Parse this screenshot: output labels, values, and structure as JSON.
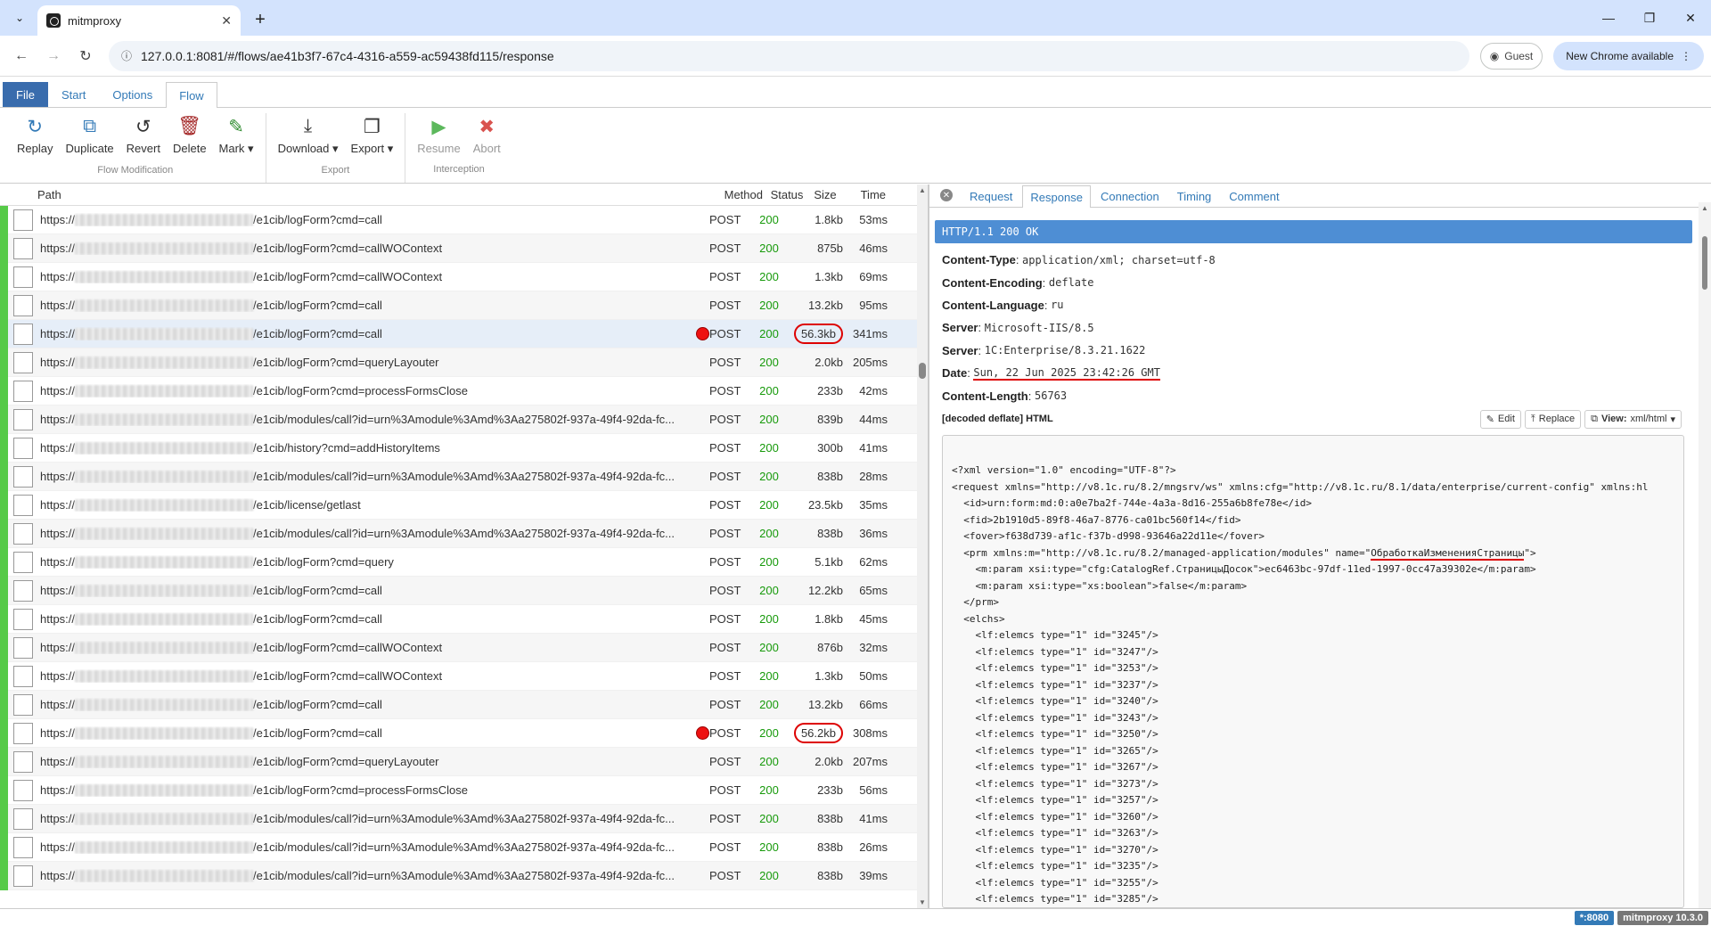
{
  "browser": {
    "tab_title": "mitmproxy",
    "url": "127.0.0.1:8081/#/flows/ae41b3f7-67c4-4316-a559-ac59438fd115/response",
    "guest_label": "Guest",
    "chrome_update_label": "New Chrome available"
  },
  "menu_tabs": [
    "File",
    "Start",
    "Options",
    "Flow"
  ],
  "ribbon": {
    "groups": [
      {
        "title": "Flow Modification",
        "buttons": [
          {
            "label": "Replay",
            "icon": "replay-icon",
            "color": "#337ab7"
          },
          {
            "label": "Duplicate",
            "icon": "duplicate-icon",
            "color": "#337ab7"
          },
          {
            "label": "Revert",
            "icon": "revert-icon",
            "color": "#333333"
          },
          {
            "label": "Delete",
            "icon": "delete-icon",
            "color": "#a52a2a"
          },
          {
            "label": "Mark",
            "icon": "mark-icon",
            "color": "#2e8b2e"
          }
        ]
      },
      {
        "title": "Export",
        "buttons": [
          {
            "label": "Download",
            "icon": "download-icon",
            "color": "#333333"
          },
          {
            "label": "Export",
            "icon": "export-icon",
            "color": "#333333"
          }
        ]
      },
      {
        "title": "Interception",
        "buttons": [
          {
            "label": "Resume",
            "icon": "resume-icon",
            "color": "#5cb85c"
          },
          {
            "label": "Abort",
            "icon": "abort-icon",
            "color": "#d9534f"
          }
        ]
      }
    ]
  },
  "flow_list": {
    "headers": {
      "path": "Path",
      "method": "Method",
      "status": "Status",
      "size": "Size",
      "time": "Time"
    },
    "rows": [
      {
        "prefix": "https://",
        "path": "/e1cib/logForm?cmd=call",
        "method": "POST",
        "status": "200",
        "size": "1.8kb",
        "time": "53ms"
      },
      {
        "prefix": "https://",
        "path": "/e1cib/logForm?cmd=callWOContext",
        "method": "POST",
        "status": "200",
        "size": "875b",
        "time": "46ms"
      },
      {
        "prefix": "https://",
        "path": "/e1cib/logForm?cmd=callWOContext",
        "method": "POST",
        "status": "200",
        "size": "1.3kb",
        "time": "69ms"
      },
      {
        "prefix": "https://",
        "path": "/e1cib/logForm?cmd=call",
        "method": "POST",
        "status": "200",
        "size": "13.2kb",
        "time": "95ms"
      },
      {
        "prefix": "https://",
        "path": "/e1cib/logForm?cmd=call",
        "method": "POST",
        "status": "200",
        "size": "56.3kb",
        "time": "341ms",
        "selected": true,
        "intercepted": true,
        "circled": true
      },
      {
        "prefix": "https://",
        "path": "/e1cib/logForm?cmd=queryLayouter",
        "method": "POST",
        "status": "200",
        "size": "2.0kb",
        "time": "205ms"
      },
      {
        "prefix": "https://",
        "path": "/e1cib/logForm?cmd=processFormsClose",
        "method": "POST",
        "status": "200",
        "size": "233b",
        "time": "42ms"
      },
      {
        "prefix": "https://",
        "path": "/e1cib/modules/call?id=urn%3Amodule%3Amd%3Aa275802f-937a-49f4-92da-fc...",
        "method": "POST",
        "status": "200",
        "size": "839b",
        "time": "44ms"
      },
      {
        "prefix": "https://",
        "path": "/e1cib/history?cmd=addHistoryItems",
        "method": "POST",
        "status": "200",
        "size": "300b",
        "time": "41ms"
      },
      {
        "prefix": "https://",
        "path": "/e1cib/modules/call?id=urn%3Amodule%3Amd%3Aa275802f-937a-49f4-92da-fc...",
        "method": "POST",
        "status": "200",
        "size": "838b",
        "time": "28ms"
      },
      {
        "prefix": "https://",
        "path": "/e1cib/license/getlast",
        "method": "POST",
        "status": "200",
        "size": "23.5kb",
        "time": "35ms"
      },
      {
        "prefix": "https://",
        "path": "/e1cib/modules/call?id=urn%3Amodule%3Amd%3Aa275802f-937a-49f4-92da-fc...",
        "method": "POST",
        "status": "200",
        "size": "838b",
        "time": "36ms"
      },
      {
        "prefix": "https://",
        "path": "/e1cib/logForm?cmd=query",
        "method": "POST",
        "status": "200",
        "size": "5.1kb",
        "time": "62ms"
      },
      {
        "prefix": "https://",
        "path": "/e1cib/logForm?cmd=call",
        "method": "POST",
        "status": "200",
        "size": "12.2kb",
        "time": "65ms"
      },
      {
        "prefix": "https://",
        "path": "/e1cib/logForm?cmd=call",
        "method": "POST",
        "status": "200",
        "size": "1.8kb",
        "time": "45ms"
      },
      {
        "prefix": "https://",
        "path": "/e1cib/logForm?cmd=callWOContext",
        "method": "POST",
        "status": "200",
        "size": "876b",
        "time": "32ms"
      },
      {
        "prefix": "https://",
        "path": "/e1cib/logForm?cmd=callWOContext",
        "method": "POST",
        "status": "200",
        "size": "1.3kb",
        "time": "50ms"
      },
      {
        "prefix": "https://",
        "path": "/e1cib/logForm?cmd=call",
        "method": "POST",
        "status": "200",
        "size": "13.2kb",
        "time": "66ms"
      },
      {
        "prefix": "https://",
        "path": "/e1cib/logForm?cmd=call",
        "method": "POST",
        "status": "200",
        "size": "56.2kb",
        "time": "308ms",
        "intercepted": true,
        "circled": true
      },
      {
        "prefix": "https://",
        "path": "/e1cib/logForm?cmd=queryLayouter",
        "method": "POST",
        "status": "200",
        "size": "2.0kb",
        "time": "207ms"
      },
      {
        "prefix": "https://",
        "path": "/e1cib/logForm?cmd=processFormsClose",
        "method": "POST",
        "status": "200",
        "size": "233b",
        "time": "56ms"
      },
      {
        "prefix": "https://",
        "path": "/e1cib/modules/call?id=urn%3Amodule%3Amd%3Aa275802f-937a-49f4-92da-fc...",
        "method": "POST",
        "status": "200",
        "size": "838b",
        "time": "41ms"
      },
      {
        "prefix": "https://",
        "path": "/e1cib/modules/call?id=urn%3Amodule%3Amd%3Aa275802f-937a-49f4-92da-fc...",
        "method": "POST",
        "status": "200",
        "size": "838b",
        "time": "26ms"
      },
      {
        "prefix": "https://",
        "path": "/e1cib/modules/call?id=urn%3Amodule%3Amd%3Aa275802f-937a-49f4-92da-fc...",
        "method": "POST",
        "status": "200",
        "size": "838b",
        "time": "39ms"
      }
    ]
  },
  "detail": {
    "tabs": [
      "Request",
      "Response",
      "Connection",
      "Timing",
      "Comment"
    ],
    "active_tab": "Response",
    "status_line": "HTTP/1.1 200 OK",
    "headers": [
      {
        "key": "Content-Type",
        "value": "application/xml; charset=utf-8"
      },
      {
        "key": "Content-Encoding",
        "value": "deflate"
      },
      {
        "key": "Content-Language",
        "value": "ru"
      },
      {
        "key": "Server",
        "value": "Microsoft-IIS/8.5"
      },
      {
        "key": "Server",
        "value": "1C:Enterprise/8.3.21.1622"
      },
      {
        "key": "Date",
        "value": "Sun, 22 Jun 2025 23:42:26 GMT",
        "underlined": true
      },
      {
        "key": "Content-Length",
        "value": "56763"
      }
    ],
    "content_title": "[decoded deflate] HTML",
    "edit_label": "Edit",
    "replace_label": "Replace",
    "view_label": "View:",
    "view_value": "xml/html",
    "code_lines": [
      "<?xml version=\"1.0\" encoding=\"UTF-8\"?>",
      "<request xmlns=\"http://v8.1c.ru/8.2/mngsrv/ws\" xmlns:cfg=\"http://v8.1c.ru/8.1/data/enterprise/current-config\" xmlns:hl",
      "  <id>urn:form:md:0:a0e7ba2f-744e-4a3a-8d16-255a6b8fe78e</id>",
      "  <fid>2b1910d5-89f8-46a7-8776-ca01bc560f14</fid>",
      "  <fover>f638d739-af1c-f37b-d998-93646a22d11e</fover>",
      "  <prm xmlns:m=\"http://v8.1c.ru/8.2/managed-application/modules\" name=\"ОбработкаИзмененияСтраницы\">",
      "    <m:param xsi:type=\"cfg:CatalogRef.СтраницыДосок\">ec6463bc-97df-11ed-1997-0cc47a39302e</m:param>",
      "    <m:param xsi:type=\"xs:boolean\">false</m:param>",
      "  </prm>",
      "  <elchs>",
      "    <lf:elemcs type=\"1\" id=\"3245\"/>",
      "    <lf:elemcs type=\"1\" id=\"3247\"/>",
      "    <lf:elemcs type=\"1\" id=\"3253\"/>",
      "    <lf:elemcs type=\"1\" id=\"3237\"/>",
      "    <lf:elemcs type=\"1\" id=\"3240\"/>",
      "    <lf:elemcs type=\"1\" id=\"3243\"/>",
      "    <lf:elemcs type=\"1\" id=\"3250\"/>",
      "    <lf:elemcs type=\"1\" id=\"3265\"/>",
      "    <lf:elemcs type=\"1\" id=\"3267\"/>",
      "    <lf:elemcs type=\"1\" id=\"3273\"/>",
      "    <lf:elemcs type=\"1\" id=\"3257\"/>",
      "    <lf:elemcs type=\"1\" id=\"3260\"/>",
      "    <lf:elemcs type=\"1\" id=\"3263\"/>",
      "    <lf:elemcs type=\"1\" id=\"3270\"/>",
      "    <lf:elemcs type=\"1\" id=\"3235\"/>",
      "    <lf:elemcs type=\"1\" id=\"3255\"/>",
      "    <lf:elemcs type=\"1\" id=\"3285\"/>"
    ]
  },
  "statusbar": {
    "port": "*:8080",
    "version": "mitmproxy 10.3.0"
  }
}
